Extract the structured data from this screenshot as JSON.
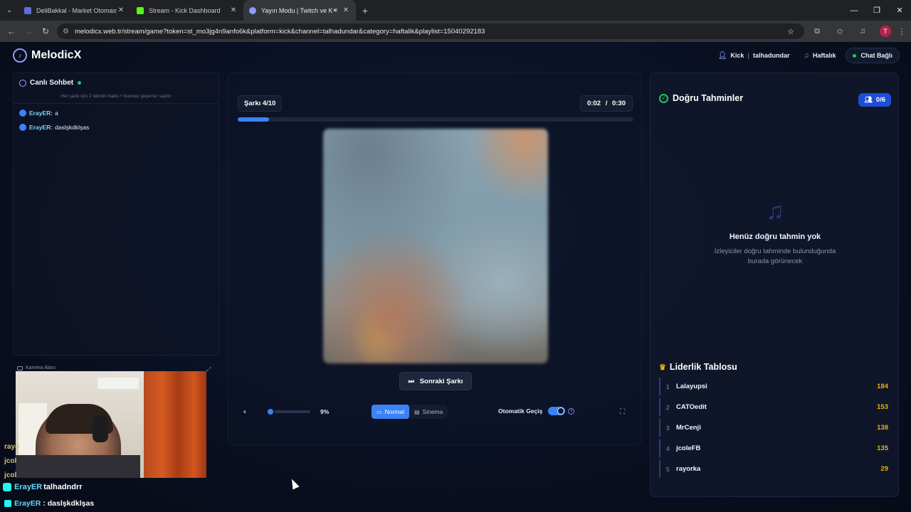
{
  "browser": {
    "tabs": [
      {
        "title": "DeliBakkal - Market Otomasyonu",
        "favicon_color": "#5b6ee1"
      },
      {
        "title": "Stream - Kick Dashboard",
        "favicon_color": "#53fc18"
      },
      {
        "title": "Yayın Modu | Twitch ve Kick",
        "favicon_color": "#8a9cf8"
      }
    ],
    "new_tab": "+",
    "url": "melodicx.web.tr/stream/game?token=st_mo3jg4n9anfo6k&platform=kick&channel=talhadundar&category=haftalik&playlist=15040292183",
    "profile_initial": "T"
  },
  "app": {
    "brand": "MelodicX",
    "platform": "Kick",
    "channel": "talhadundar",
    "category": "Haftalık",
    "chat_status": "Chat Bağlı"
  },
  "chat": {
    "title": "Canlı Sohbet",
    "note": "Her şarkı için 2 tahmin hakkı • Sonrası geçersiz sayılır",
    "messages": [
      {
        "user": "ErayER:",
        "text": "a"
      },
      {
        "user": "ErayER:",
        "text": "daslşkdklşas"
      }
    ]
  },
  "camera": {
    "label": "Kamera Alanı"
  },
  "stream_overlay": {
    "partial_lines": [
      "rayo",
      "jcol",
      "jcol"
    ],
    "tiktok_user": "ErayER",
    "tiktok_handle": "talhadndrr",
    "last_user": "ErayER",
    "last_text": ": daslşkdklşas"
  },
  "player": {
    "song_label": "Şarkı 4/10",
    "time_current": "0:02",
    "time_sep": "/",
    "time_total": "0:30",
    "progress_fraction": 0.08,
    "next_label": "Sonraki Şarkı",
    "volume_label": "9%",
    "volume_fraction": 0.09,
    "mode_normal": "Normal",
    "mode_cinema": "Sinema",
    "auto_label": "Otomatik Geçiş",
    "auto_on": true
  },
  "correct": {
    "title": "Doğru Tahminler",
    "count": "0/6",
    "empty_title": "Henüz doğru tahmin yok",
    "empty_line1": "İzleyiciler doğru tahminde bulunduğunda",
    "empty_line2": "burada görünecek"
  },
  "leaderboard": {
    "title": "Liderlik Tablosu",
    "rows": [
      {
        "rank": "1",
        "name": "Lalayupsi",
        "score": "184"
      },
      {
        "rank": "2",
        "name": "CATOedit",
        "score": "153"
      },
      {
        "rank": "3",
        "name": "MrCenji",
        "score": "138"
      },
      {
        "rank": "4",
        "name": "jcoleFB",
        "score": "135"
      },
      {
        "rank": "5",
        "name": "rayorka",
        "score": "29"
      }
    ]
  },
  "colors": {
    "accent": "#3b82f6",
    "success": "#22c55e",
    "score": "#eab308",
    "background": "#0a0f1e"
  }
}
